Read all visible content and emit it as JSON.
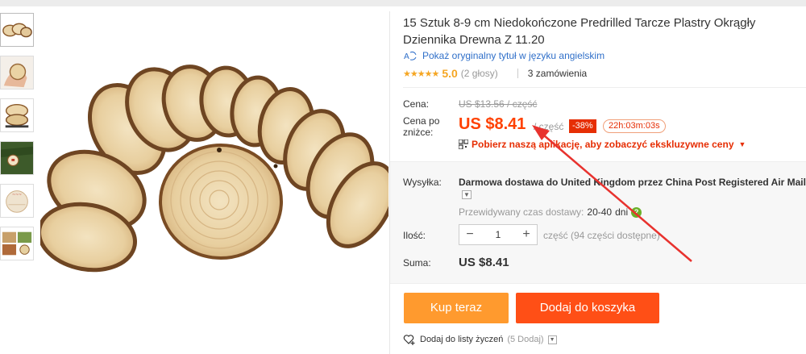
{
  "product": {
    "title": "15 Sztuk 8-9 cm Niedokończone Predrilled Tarcze Plastry Okrągły Dziennika Drewna Z 11.20",
    "translate_link": "Pokaż oryginalny tytuł w języku angielskim",
    "rating": {
      "stars": "★★★★★",
      "score": "5.0",
      "votes": "(2 głosy)"
    },
    "orders": "3 zamówienia"
  },
  "price": {
    "label_price": "Cena:",
    "old": "US $13.56 / część",
    "label_discount_price": "Cena po zniżce:",
    "current": "US $8.41",
    "per_unit": "/ część",
    "discount": "-38%",
    "timer": "22h:03m:03s",
    "app_promo": "Pobierz naszą aplikację, aby zobaczyć ekskluzywne ceny"
  },
  "shipping": {
    "label": "Wysyłka:",
    "method": "Darmowa dostawa do United Kingdom przez China Post Registered Air Mail",
    "delivery_label": "Przewidywany czas dostawy:",
    "delivery_days": "20-40",
    "delivery_suffix": "dni"
  },
  "quantity": {
    "label": "Ilość:",
    "value": "1",
    "minus": "−",
    "plus": "+",
    "available": "część (94 części dostępne)"
  },
  "summary": {
    "label": "Suma:",
    "total": "US $8.41"
  },
  "actions": {
    "buy_now": "Kup teraz",
    "add_to_cart": "Dodaj do koszyka",
    "wishlist": "Dodaj do listy życzeń",
    "wishlist_count": "(5 Dodaj)"
  },
  "colors": {
    "price": "#ff4100",
    "buy_now": "#ff9a2e",
    "add_to_cart": "#ff4f16",
    "discount_badge": "#e62e04",
    "link": "#2f6fc9",
    "star": "#f5a623",
    "annotation_arrow": "#e8322e"
  }
}
